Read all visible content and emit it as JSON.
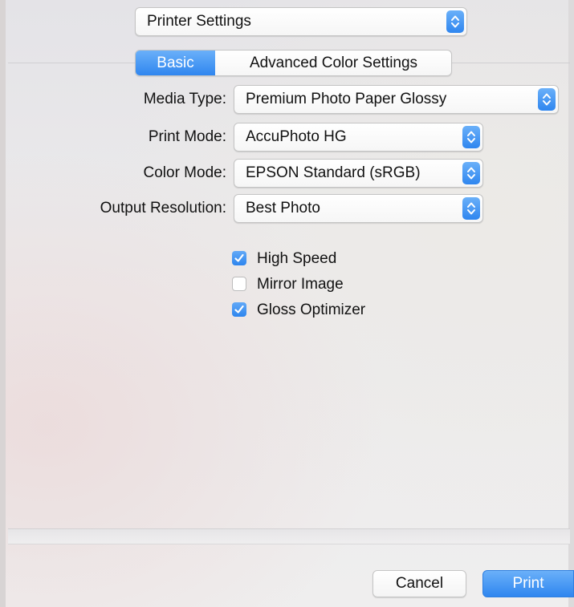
{
  "panel_selector": {
    "value": "Printer Settings"
  },
  "tabs": [
    {
      "label": "Basic",
      "active": true
    },
    {
      "label": "Advanced Color Settings",
      "active": false
    }
  ],
  "form": {
    "media_type": {
      "label": "Media Type:",
      "value": "Premium Photo Paper Glossy"
    },
    "print_mode": {
      "label": "Print Mode:",
      "value": "AccuPhoto HG"
    },
    "color_mode": {
      "label": "Color Mode:",
      "value": "EPSON Standard (sRGB)"
    },
    "output_resolution": {
      "label": "Output Resolution:",
      "value": "Best Photo"
    }
  },
  "options": [
    {
      "label": "High Speed",
      "checked": true
    },
    {
      "label": "Mirror Image",
      "checked": false
    },
    {
      "label": "Gloss Optimizer",
      "checked": true
    }
  ],
  "buttons": {
    "cancel": "Cancel",
    "print": "Print"
  },
  "colors": {
    "accent": "#2f86ef",
    "accent_light": "#6ab0f9"
  }
}
